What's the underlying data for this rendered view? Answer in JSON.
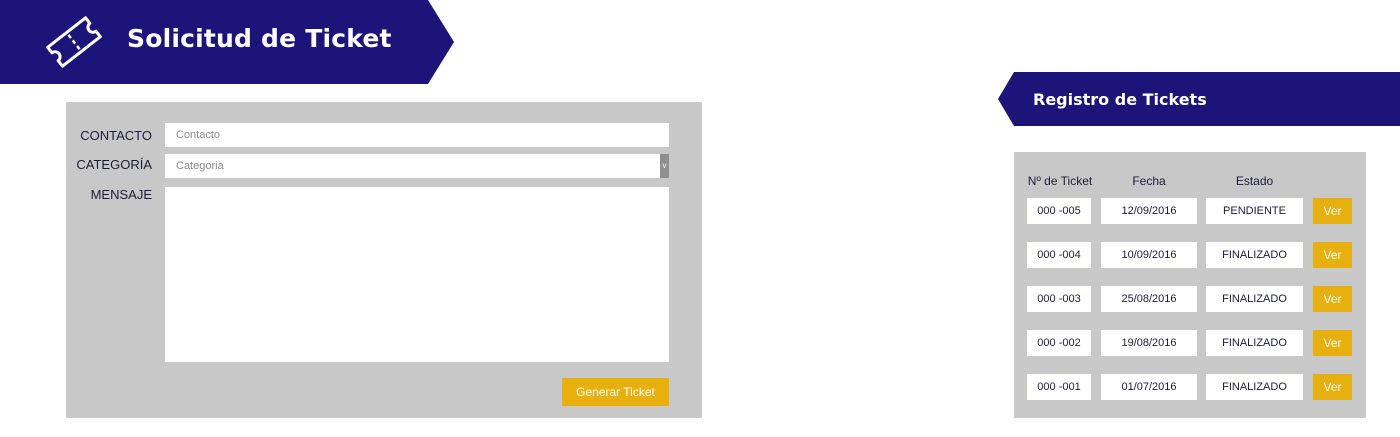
{
  "header": {
    "title": "Solicitud de Ticket",
    "icon": "ticket-icon",
    "background": "#1c1478"
  },
  "form": {
    "contact_label": "CONTACTO",
    "contact_placeholder": "Contacto",
    "category_label": "CATEGORÍA",
    "category_placeholder": "Categoria",
    "category_arrow": "v",
    "message_label": "MENSAJE",
    "message_value": "",
    "submit_label": "Generar Ticket"
  },
  "registry": {
    "title": "Registro de Tickets",
    "columns": [
      "Nº de Ticket",
      "Fecha",
      "Estado"
    ],
    "rows": [
      {
        "number": "000 -005",
        "date": "12/09/2016",
        "status": "PENDIENTE",
        "action": "Ver"
      },
      {
        "number": "000 -004",
        "date": "10/09/2016",
        "status": "FINALIZADO",
        "action": "Ver"
      },
      {
        "number": "000 -003",
        "date": "25/08/2016",
        "status": "FINALIZADO",
        "action": "Ver"
      },
      {
        "number": "000 -002",
        "date": "19/08/2016",
        "status": "FINALIZADO",
        "action": "Ver"
      },
      {
        "number": "000 -001",
        "date": "01/07/2016",
        "status": "FINALIZADO",
        "action": "Ver"
      }
    ]
  },
  "colors": {
    "navy": "#1c1478",
    "panel": "#c8c8c8",
    "accent": "#e8b00f"
  }
}
